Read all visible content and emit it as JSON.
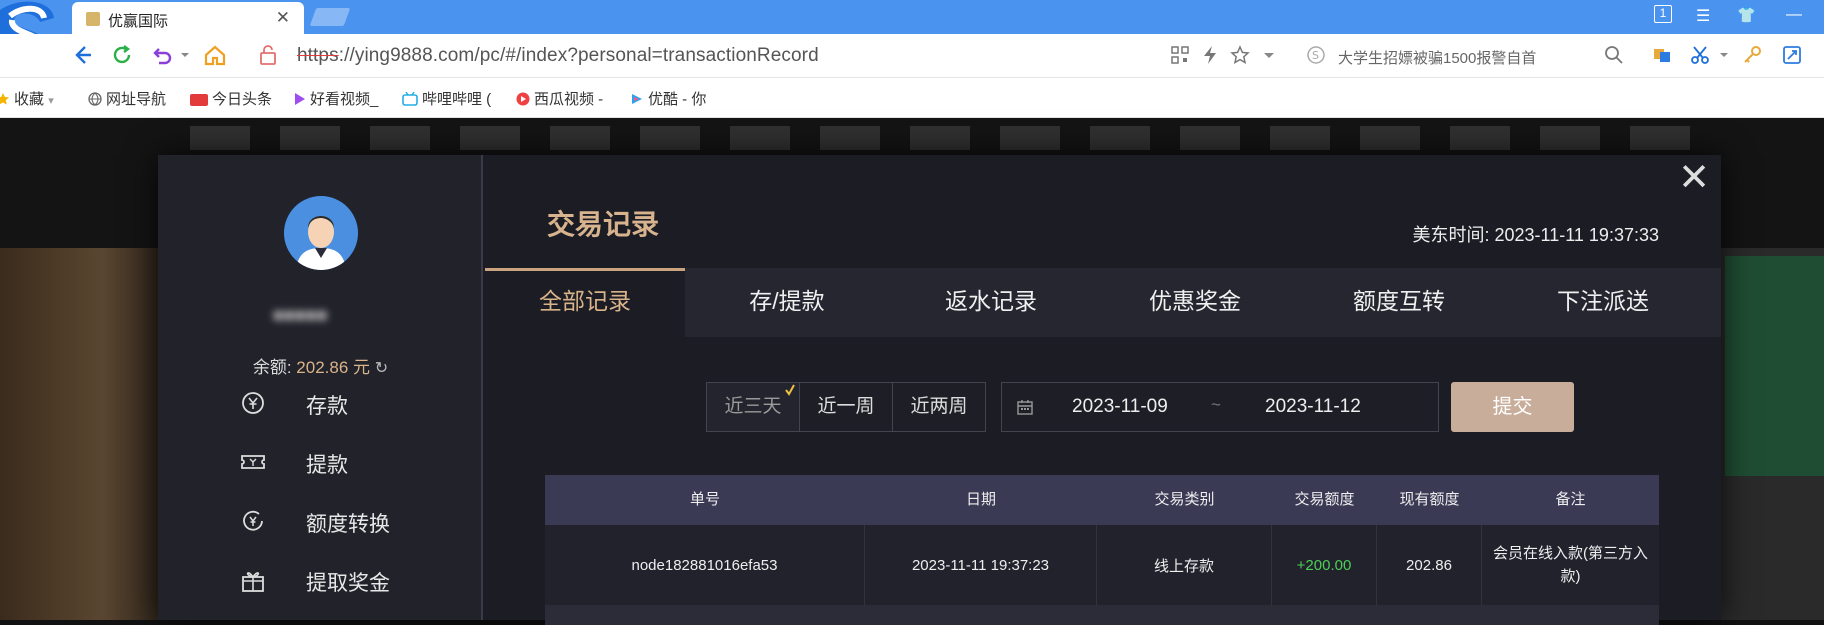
{
  "browser": {
    "tab_title": "优赢国际",
    "tab_close": "✕",
    "url_protocol": "https",
    "url_rest": "://ying9888.com/pc/#/index?personal=transactionRecord",
    "search_text": "大学生招嫖被骗1500报警自首",
    "window_controls": [
      "1",
      "☰",
      "👕",
      "—"
    ]
  },
  "bookmarks": [
    {
      "label": "收藏",
      "icon": "star-icon",
      "color": "#f4b400"
    },
    {
      "label": "网址导航",
      "icon": "globe-icon",
      "color": "#666666"
    },
    {
      "label": "今日头条",
      "icon": "toutiao-icon",
      "color": "#e33b3b"
    },
    {
      "label": "好看视频_",
      "icon": "play-icon",
      "color": "#a04df0"
    },
    {
      "label": "哔哩哔哩 (",
      "icon": "bilibili-icon",
      "color": "#23ade5"
    },
    {
      "label": "西瓜视频 -",
      "icon": "xigua-icon",
      "color": "#f04142"
    },
    {
      "label": "优酷 - 你",
      "icon": "youku-icon",
      "color": "#2aa3ef"
    }
  ],
  "sidebar": {
    "balance_label": "余额:",
    "balance_amount": "202.86 元",
    "items": [
      {
        "label": "存款",
        "icon": "yen-circle-icon"
      },
      {
        "label": "提款",
        "icon": "ticket-icon"
      },
      {
        "label": "额度转换",
        "icon": "yen-refresh-icon"
      },
      {
        "label": "提取奖金",
        "icon": "gift-icon"
      }
    ]
  },
  "main": {
    "title": "交易记录",
    "us_time": "美东时间: 2023-11-11 19:37:33",
    "tabs": [
      {
        "label": "全部记录",
        "active": true
      },
      {
        "label": "存/提款",
        "active": false
      },
      {
        "label": "返水记录",
        "active": false
      },
      {
        "label": "优惠奖金",
        "active": false
      },
      {
        "label": "额度互转",
        "active": false
      },
      {
        "label": "下注派送",
        "active": false
      }
    ],
    "range_options": [
      {
        "label": "近三天",
        "active": true
      },
      {
        "label": "近一周",
        "active": false
      },
      {
        "label": "近两周",
        "active": false
      }
    ],
    "date_from": "2023-11-09",
    "date_sep": "~",
    "date_to": "2023-11-12",
    "submit_label": "提交"
  },
  "table": {
    "columns": [
      "单号",
      "日期",
      "交易类别",
      "交易额度",
      "现有额度",
      "备注"
    ],
    "rows": [
      {
        "id": "node182881016efa53",
        "date": "2023-11-11 19:37:23",
        "type": "线上存款",
        "amount": "+200.00",
        "balance": "202.86",
        "note": "会员在线入款(第三方入款)"
      }
    ]
  },
  "colors": {
    "accent_gold": "#d9b48a",
    "browser_blue": "#4a94f0",
    "positive_green": "#4bd053",
    "table_header": "#3a3a55"
  }
}
